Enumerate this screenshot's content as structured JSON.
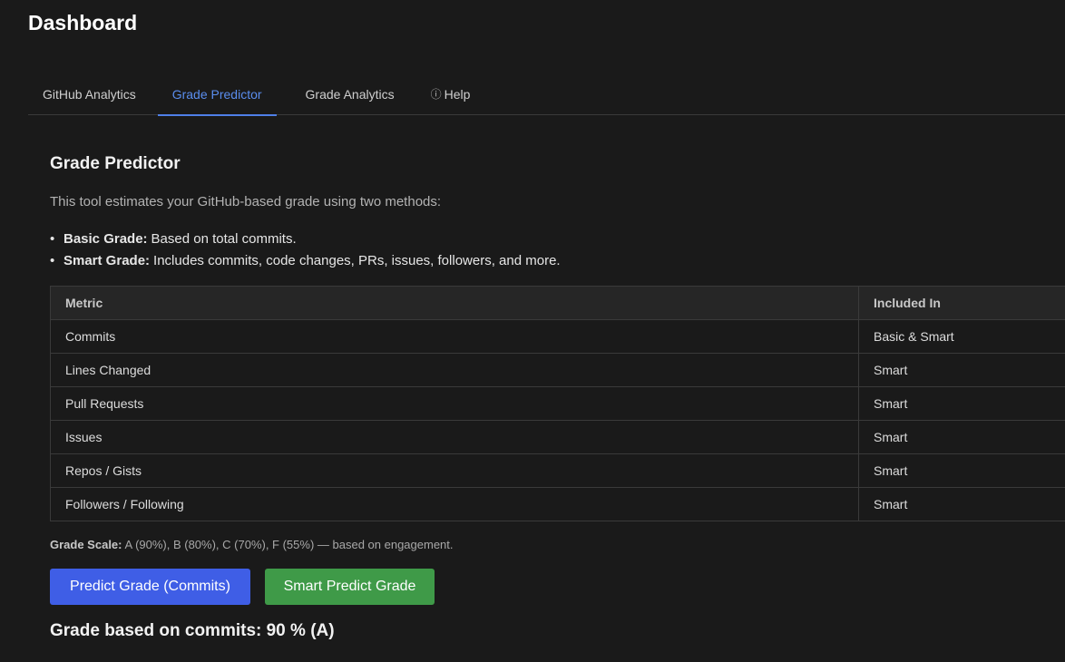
{
  "header": {
    "title": "Dashboard"
  },
  "tabs": [
    {
      "label": "GitHub Analytics",
      "active": false
    },
    {
      "label": "Grade Predictor",
      "active": true
    },
    {
      "label": "Grade Analytics",
      "active": false
    },
    {
      "label": "Help",
      "icon": "info-circle-icon",
      "icon_glyph": "ⓘ",
      "active": false
    }
  ],
  "colors": {
    "accent": "#4f7fe8",
    "basic_button": "#3f5ee6",
    "smart_button": "#3f9a48",
    "background": "#1a1a1a"
  },
  "section": {
    "title": "Grade Predictor",
    "description": "This tool estimates your GitHub-based grade using two methods:",
    "methods": [
      {
        "name": "Basic Grade:",
        "text": "Based on total commits."
      },
      {
        "name": "Smart Grade:",
        "text": "Includes commits, code changes, PRs, issues, followers, and more."
      }
    ]
  },
  "table": {
    "headers": [
      "Metric",
      "Included In"
    ],
    "rows": [
      [
        "Commits",
        "Basic & Smart"
      ],
      [
        "Lines Changed",
        "Smart"
      ],
      [
        "Pull Requests",
        "Smart"
      ],
      [
        "Issues",
        "Smart"
      ],
      [
        "Repos / Gists",
        "Smart"
      ],
      [
        "Followers / Following",
        "Smart"
      ]
    ]
  },
  "grade_scale": {
    "label": "Grade Scale:",
    "text": "A (90%), B (80%), C (70%), F (55%) — based on engagement."
  },
  "buttons": {
    "basic": "Predict Grade (Commits)",
    "smart": "Smart Predict Grade"
  },
  "result": "Grade based on commits: 90 % (A)"
}
